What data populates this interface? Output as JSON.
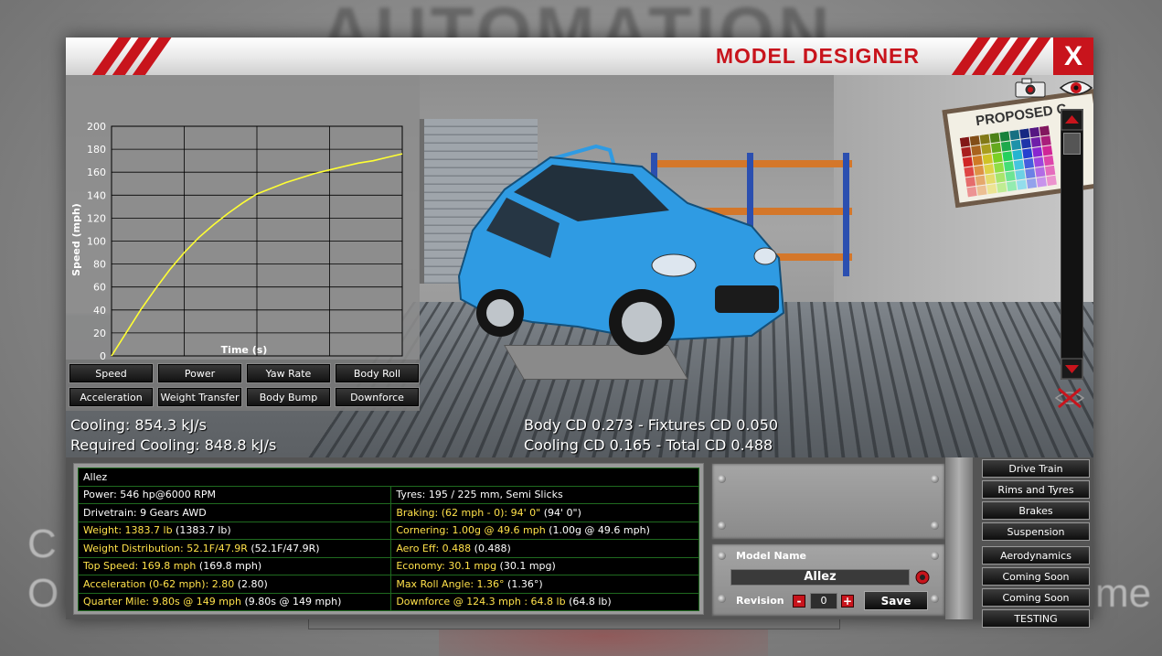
{
  "window": {
    "title": "MODEL DESIGNER",
    "close_label": "X"
  },
  "backdrop": {
    "title": "AUTOMATION",
    "left_text_line1": "C",
    "left_text_line2": "O",
    "right_text": "me"
  },
  "scene": {
    "board_title": "PROPOSED C"
  },
  "chart_data": {
    "type": "line",
    "x": [
      0,
      1,
      2,
      3,
      4,
      5,
      6,
      7,
      8,
      9,
      10,
      11,
      12,
      13,
      14,
      15,
      16,
      17,
      18,
      19,
      20
    ],
    "series": [
      {
        "values": [
          0,
          20,
          40,
          58,
          75,
          90,
          103,
          114,
          124,
          133,
          141,
          146,
          151,
          155,
          159,
          162,
          165,
          168,
          170,
          173,
          176
        ]
      }
    ],
    "xlabel": "Time (s)",
    "ylabel": "Speed (mph)",
    "xlim": [
      0,
      20
    ],
    "ylim": [
      0,
      200
    ],
    "x_ticks": [
      "0",
      "10",
      "20"
    ],
    "y_ticks": [
      "0",
      "20",
      "40",
      "60",
      "80",
      "100",
      "120",
      "140",
      "160",
      "180",
      "200"
    ],
    "grid": true,
    "line_color": "#ffff33"
  },
  "graph_buttons": [
    "Speed",
    "Power",
    "Yaw Rate",
    "Body Roll",
    "Acceleration",
    "Weight Transfer",
    "Body Bump",
    "Downforce"
  ],
  "overlay": {
    "cooling": "Cooling: 854.3 kJ/s",
    "required_cooling": "Required Cooling: 848.8 kJ/s",
    "body_cd": "Body CD 0.273 - Fixtures CD 0.050",
    "cooling_cd": "Cooling CD 0.165 - Total CD 0.488"
  },
  "stats": {
    "model": "Allez",
    "rows": [
      {
        "l_label": "Power: 546 hp@6000 RPM",
        "l_value": "",
        "l_hl": false,
        "r_label": "Tyres: 195 / 225 mm, Semi Slicks",
        "r_value": "",
        "r_hl": false
      },
      {
        "l_label": "Drivetrain: 9 Gears AWD",
        "l_value": "",
        "l_hl": false,
        "r_label": "Braking: (62 mph - 0): 94' 0\"",
        "r_value": " (94' 0\")",
        "r_hl": true
      },
      {
        "l_label": "Weight: 1383.7 lb",
        "l_value": " (1383.7 lb)",
        "l_hl": true,
        "r_label": "Cornering: 1.00g @ 49.6 mph",
        "r_value": " (1.00g @ 49.6 mph)",
        "r_hl": true
      },
      {
        "l_label": "Weight Distribution: 52.1F/47.9R",
        "l_value": " (52.1F/47.9R)",
        "l_hl": true,
        "r_label": "Aero Eff: 0.488",
        "r_value": " (0.488)",
        "r_hl": true
      },
      {
        "l_label": "Top Speed: 169.8 mph",
        "l_value": " (169.8 mph)",
        "l_hl": true,
        "r_label": "Economy: 30.1 mpg",
        "r_value": " (30.1 mpg)",
        "r_hl": true
      },
      {
        "l_label": "Acceleration (0-62 mph): 2.80",
        "l_value": " (2.80)",
        "l_hl": true,
        "r_label": "Max Roll Angle: 1.36°",
        "r_value": " (1.36°)",
        "r_hl": true
      },
      {
        "l_label": "Quarter Mile: 9.80s @ 149 mph",
        "l_value": " (9.80s @ 149 mph)",
        "l_hl": true,
        "r_label": "Downforce @ 124.3 mph : 64.8 lb",
        "r_value": " (64.8 lb)",
        "r_hl": true
      }
    ]
  },
  "model_form": {
    "model_name_label": "Model Name",
    "model_name_value": "Allez",
    "revision_label": "Revision",
    "revision_value": "0",
    "minus_label": "-",
    "plus_label": "+",
    "save_label": "Save"
  },
  "nav": {
    "items": [
      "Drive Train",
      "Rims and Tyres",
      "Brakes",
      "Suspension",
      "Aerodynamics",
      "Coming Soon",
      "Coming Soon",
      "TESTING"
    ]
  },
  "colors": {
    "accent_red": "#c8141c",
    "highlight_yellow": "#ffe14a",
    "table_grid_green": "#1f6a1f",
    "car_blue": "#2f9be3"
  },
  "icons": {
    "camera": "camera-icon",
    "eye": "eye-icon",
    "hide": "hide-icon",
    "scroll_up": "chevron-up-icon",
    "scroll_down": "chevron-down-icon",
    "rename": "rename-icon"
  }
}
